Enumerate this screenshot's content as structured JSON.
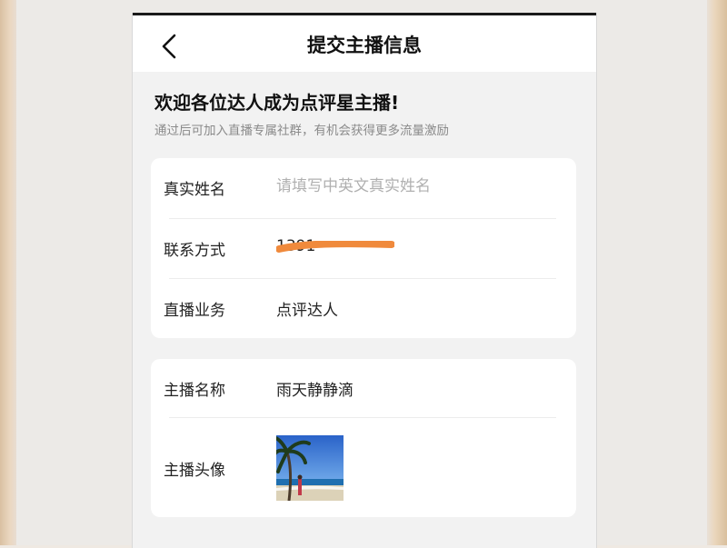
{
  "nav": {
    "title": "提交主播信息"
  },
  "intro": {
    "welcome": "欢迎各位达人成为点评星主播!",
    "subtitle": "通过后可加入直播专属社群，有机会获得更多流量激励"
  },
  "form": {
    "real_name": {
      "label": "真实姓名",
      "value": "",
      "placeholder": "请填写中英文真实姓名"
    },
    "contact": {
      "label": "联系方式",
      "value": "1391"
    },
    "business": {
      "label": "直播业务",
      "value": "点评达人"
    }
  },
  "profile": {
    "anchor_name": {
      "label": "主播名称",
      "value": "雨天静静滴"
    },
    "avatar": {
      "label": "主播头像",
      "icon": "avatar-beach-photo"
    }
  },
  "colors": {
    "redaction": "#f08a3c",
    "card": "#ffffff",
    "page": "#f2f2f2"
  }
}
